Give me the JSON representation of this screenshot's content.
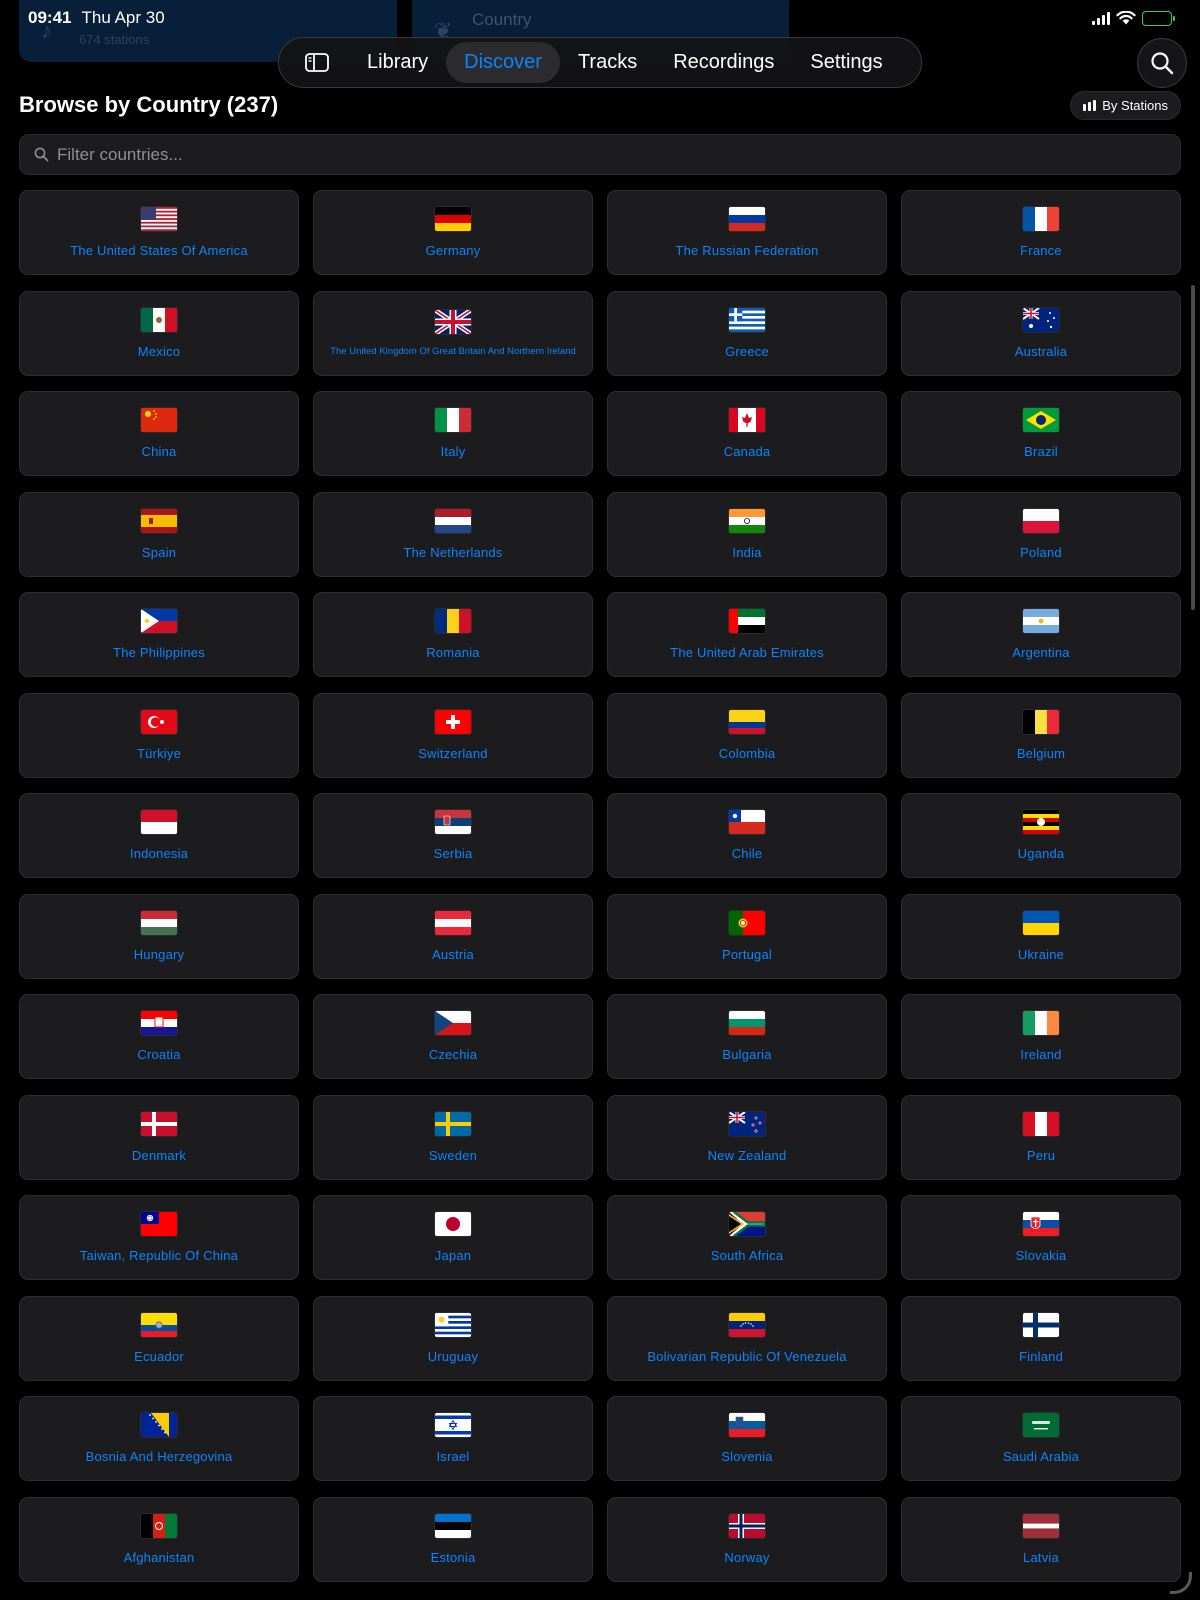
{
  "background_cards": [
    {
      "title": "",
      "subtitle": "674 stations",
      "icon": "music-note-icon"
    },
    {
      "title": "Country",
      "subtitle": "",
      "icon": "leaf-icon"
    }
  ],
  "status_bar": {
    "time": "09:41",
    "date": "Thu Apr 30"
  },
  "nav": {
    "tabs": [
      {
        "label": "Library",
        "active": false
      },
      {
        "label": "Discover",
        "active": true
      },
      {
        "label": "Tracks",
        "active": false
      },
      {
        "label": "Recordings",
        "active": false
      },
      {
        "label": "Settings",
        "active": false
      }
    ]
  },
  "header": {
    "title": "Browse by Country (237)",
    "sort_label": "By Stations"
  },
  "filter": {
    "placeholder": "Filter countries...",
    "value": ""
  },
  "colors": {
    "accent": "#0a84ff",
    "card": "#1c1c1e",
    "background": "#000000",
    "battery": "#30d158"
  },
  "countries": [
    {
      "name": "The United States Of America",
      "flag": "us"
    },
    {
      "name": "Germany",
      "flag": "de"
    },
    {
      "name": "The Russian Federation",
      "flag": "ru"
    },
    {
      "name": "France",
      "flag": "fr"
    },
    {
      "name": "Mexico",
      "flag": "mx"
    },
    {
      "name": "The United Kingdom Of Great Britain And Northern Ireland",
      "flag": "gb"
    },
    {
      "name": "Greece",
      "flag": "gr"
    },
    {
      "name": "Australia",
      "flag": "au"
    },
    {
      "name": "China",
      "flag": "cn"
    },
    {
      "name": "Italy",
      "flag": "it"
    },
    {
      "name": "Canada",
      "flag": "ca"
    },
    {
      "name": "Brazil",
      "flag": "br"
    },
    {
      "name": "Spain",
      "flag": "es"
    },
    {
      "name": "The Netherlands",
      "flag": "nl"
    },
    {
      "name": "India",
      "flag": "in"
    },
    {
      "name": "Poland",
      "flag": "pl"
    },
    {
      "name": "The Philippines",
      "flag": "ph"
    },
    {
      "name": "Romania",
      "flag": "ro"
    },
    {
      "name": "The United Arab Emirates",
      "flag": "ae"
    },
    {
      "name": "Argentina",
      "flag": "ar"
    },
    {
      "name": "Türkiye",
      "flag": "tr"
    },
    {
      "name": "Switzerland",
      "flag": "ch"
    },
    {
      "name": "Colombia",
      "flag": "co"
    },
    {
      "name": "Belgium",
      "flag": "be"
    },
    {
      "name": "Indonesia",
      "flag": "id"
    },
    {
      "name": "Serbia",
      "flag": "rs"
    },
    {
      "name": "Chile",
      "flag": "cl"
    },
    {
      "name": "Uganda",
      "flag": "ug"
    },
    {
      "name": "Hungary",
      "flag": "hu"
    },
    {
      "name": "Austria",
      "flag": "at"
    },
    {
      "name": "Portugal",
      "flag": "pt"
    },
    {
      "name": "Ukraine",
      "flag": "ua"
    },
    {
      "name": "Croatia",
      "flag": "hr"
    },
    {
      "name": "Czechia",
      "flag": "cz"
    },
    {
      "name": "Bulgaria",
      "flag": "bg"
    },
    {
      "name": "Ireland",
      "flag": "ie"
    },
    {
      "name": "Denmark",
      "flag": "dk"
    },
    {
      "name": "Sweden",
      "flag": "se"
    },
    {
      "name": "New Zealand",
      "flag": "nz"
    },
    {
      "name": "Peru",
      "flag": "pe"
    },
    {
      "name": "Taiwan, Republic Of China",
      "flag": "tw"
    },
    {
      "name": "Japan",
      "flag": "jp"
    },
    {
      "name": "South Africa",
      "flag": "za"
    },
    {
      "name": "Slovakia",
      "flag": "sk"
    },
    {
      "name": "Ecuador",
      "flag": "ec"
    },
    {
      "name": "Uruguay",
      "flag": "uy"
    },
    {
      "name": "Bolivarian Republic Of Venezuela",
      "flag": "ve"
    },
    {
      "name": "Finland",
      "flag": "fi"
    },
    {
      "name": "Bosnia And Herzegovina",
      "flag": "ba"
    },
    {
      "name": "Israel",
      "flag": "il"
    },
    {
      "name": "Slovenia",
      "flag": "si"
    },
    {
      "name": "Saudi Arabia",
      "flag": "sa"
    },
    {
      "name": "Afghanistan",
      "flag": "af"
    },
    {
      "name": "Estonia",
      "flag": "ee"
    },
    {
      "name": "Norway",
      "flag": "no"
    },
    {
      "name": "Latvia",
      "flag": "lv"
    }
  ]
}
